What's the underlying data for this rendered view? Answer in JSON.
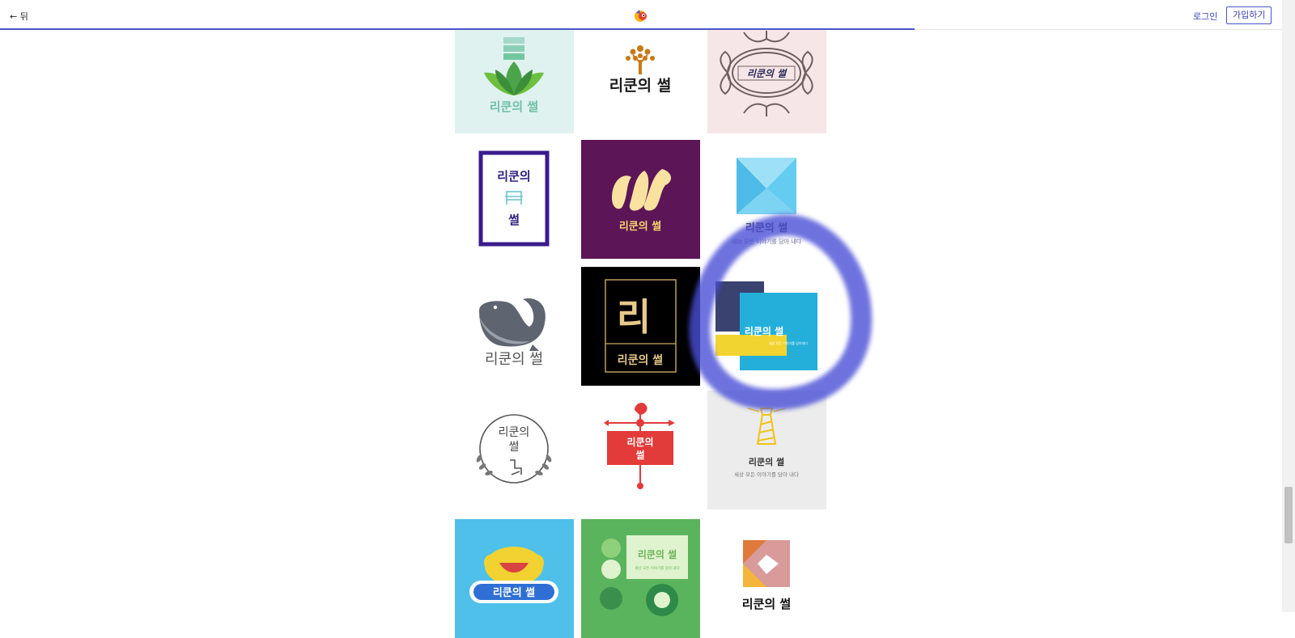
{
  "header": {
    "back_label": "← 뒤",
    "login_label": "로그인",
    "signup_label": "가입하기"
  },
  "logos": {
    "brand": "리쿤의 썰",
    "brand_line1": "리쿤의",
    "brand_line2": "썰",
    "big_letter": "리",
    "tagline": "세상 모든 이야기를 담아 내다",
    "tagline_short": "세상 모든 이야기를 담아내다"
  },
  "colors": {
    "accent": "#4a55c7",
    "highlight_circle": "#4a4fd6"
  }
}
